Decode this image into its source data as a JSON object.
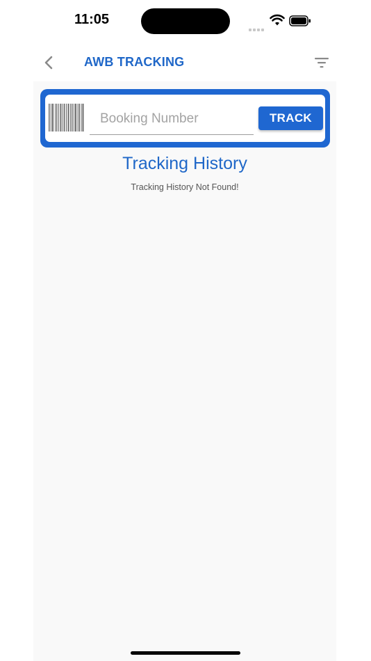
{
  "status_bar": {
    "time": "11:05"
  },
  "header": {
    "title": "AWB TRACKING",
    "back_icon": "chevron-left-icon",
    "filter_icon": "filter-icon"
  },
  "search": {
    "placeholder": "Booking Number",
    "value": "",
    "barcode_icon": "barcode-icon",
    "track_label": "TRACK"
  },
  "history": {
    "title": "Tracking History",
    "empty_message": "Tracking History Not Found!"
  },
  "colors": {
    "accent": "#1f67d1",
    "title_text": "#1f67c8",
    "panel_background": "#f9f9f9"
  }
}
